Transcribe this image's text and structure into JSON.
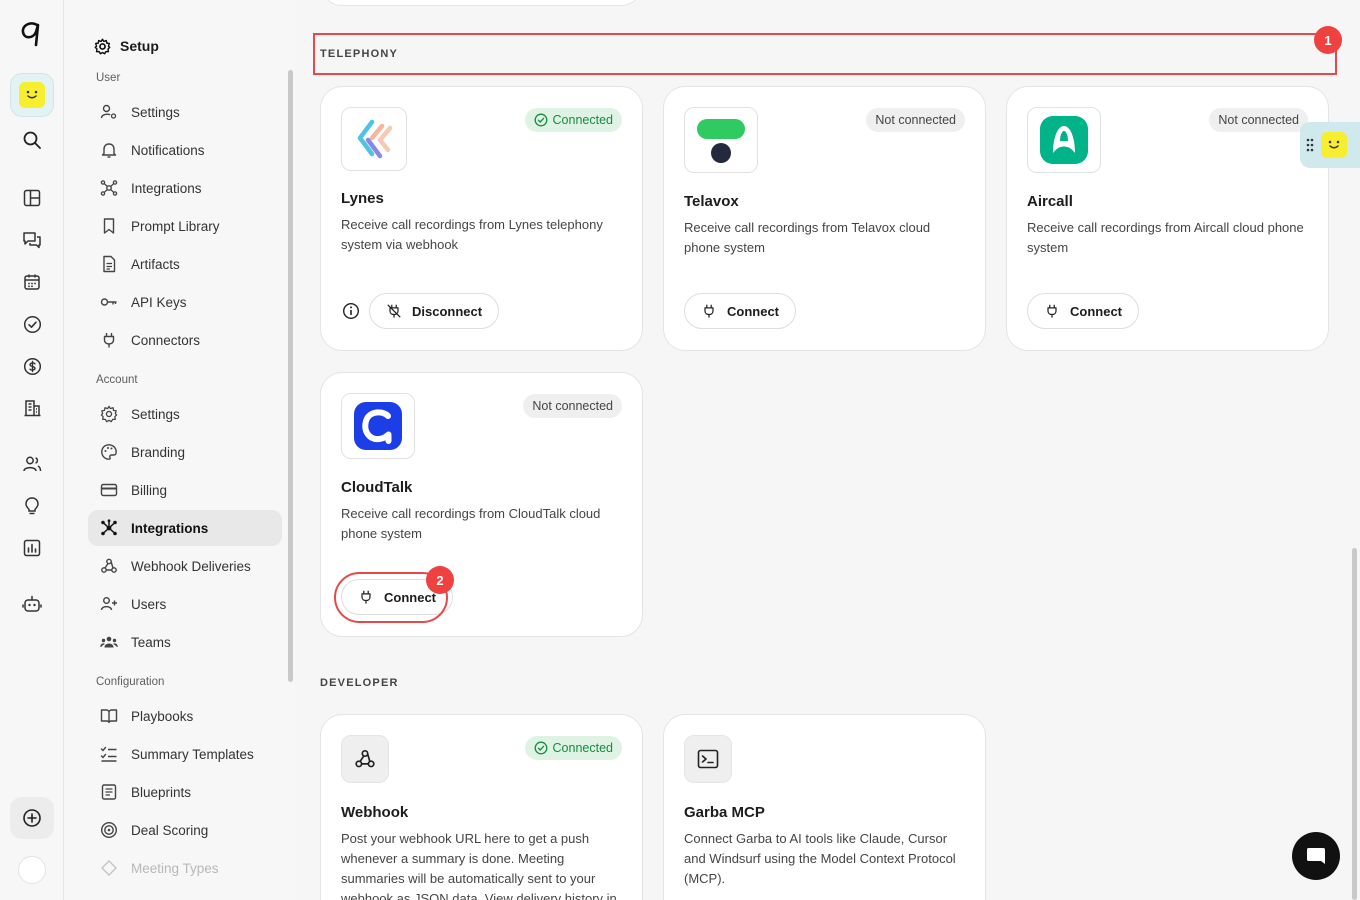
{
  "nav": {
    "title": "Setup",
    "groups": {
      "user": "User",
      "account": "Account",
      "configuration": "Configuration"
    },
    "user_items": [
      "Settings",
      "Notifications",
      "Integrations",
      "Prompt Library",
      "Artifacts",
      "API Keys",
      "Connectors"
    ],
    "account_items": [
      "Settings",
      "Branding",
      "Billing",
      "Integrations",
      "Webhook Deliveries",
      "Users",
      "Teams"
    ],
    "config_items": [
      "Playbooks",
      "Summary Templates",
      "Blueprints",
      "Deal Scoring",
      "Meeting Types"
    ],
    "active_item": "Integrations"
  },
  "sections": {
    "telephony": "TELEPHONY",
    "developer": "DEVELOPER"
  },
  "cards": {
    "lynes": {
      "title": "Lynes",
      "status": "Connected",
      "description": "Receive call recordings from Lynes telephony system via webhook",
      "action": "Disconnect"
    },
    "telavox": {
      "title": "Telavox",
      "status": "Not connected",
      "description": "Receive call recordings from Telavox cloud phone system",
      "action": "Connect"
    },
    "aircall": {
      "title": "Aircall",
      "status": "Not connected",
      "description": "Receive call recordings from Aircall cloud phone system",
      "action": "Connect"
    },
    "cloudtalk": {
      "title": "CloudTalk",
      "status": "Not connected",
      "description": "Receive call recordings from CloudTalk cloud phone system",
      "action": "Connect"
    },
    "webhook": {
      "title": "Webhook",
      "status": "Connected",
      "description": "Post your webhook URL here to get a push whenever a summary is done. Meeting summaries will be automatically sent to your webhook as JSON data. View delivery history in"
    },
    "garba_mcp": {
      "title": "Garba MCP",
      "description": "Connect Garba to AI tools like Claude, Cursor and Windsurf using the Model Context Protocol (MCP)."
    }
  },
  "annotations": {
    "badge1": "1",
    "badge2": "2"
  },
  "colors": {
    "connected_bg": "#dff3e5",
    "connected_text": "#188a3f",
    "highlight": "#e7494a",
    "widget_yellow": "#f6ee2e"
  }
}
